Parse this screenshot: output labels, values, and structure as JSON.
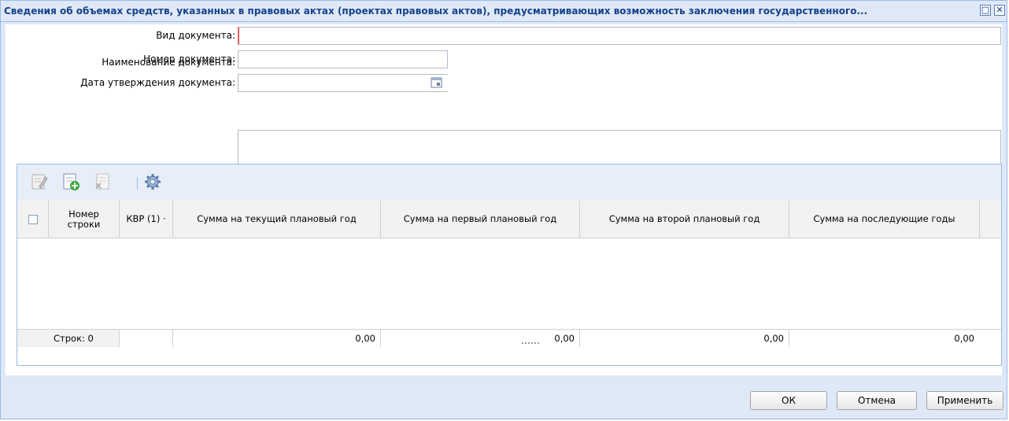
{
  "window": {
    "title": "Сведения об объемах средств, указанных в правовых актах (проектах правовых актов), предусматривающих возможность заключения государственного...",
    "maximize_icon": "restore-icon",
    "close_icon": "close-icon",
    "maximize_glyph": "□",
    "close_glyph": "✕"
  },
  "form": {
    "doc_type_label": "Вид документа:",
    "doc_type_value": "",
    "doc_number_label": "Номер документа:",
    "doc_number_value": "",
    "doc_date_label": "Дата утверждения документа:",
    "doc_date_value": "",
    "doc_name_label": "Наименование документа:",
    "doc_name_value": ""
  },
  "toolbar": {
    "icons": [
      "edit-icon",
      "add-row-icon",
      "delete-row-icon",
      "settings-icon"
    ]
  },
  "table": {
    "columns": [
      "",
      "Номер строки",
      "КВР (1)",
      "Сумма на текущий плановый год",
      "Сумма на первый плановый год",
      "Сумма на второй плановый год",
      "Сумма на последующие годы"
    ],
    "col_number_line1": "Номер",
    "col_number_line2": "строки",
    "col_kvr": "КВР (1) ·",
    "rows": [],
    "footer": {
      "rows_count": "Строк: 0",
      "sum_current": "0,00",
      "sum_first": "0,00",
      "sum_second": "0,00",
      "sum_next": "0,00"
    }
  },
  "buttons": {
    "ok": "ОК",
    "cancel": "Отмена",
    "apply": "Применить"
  }
}
